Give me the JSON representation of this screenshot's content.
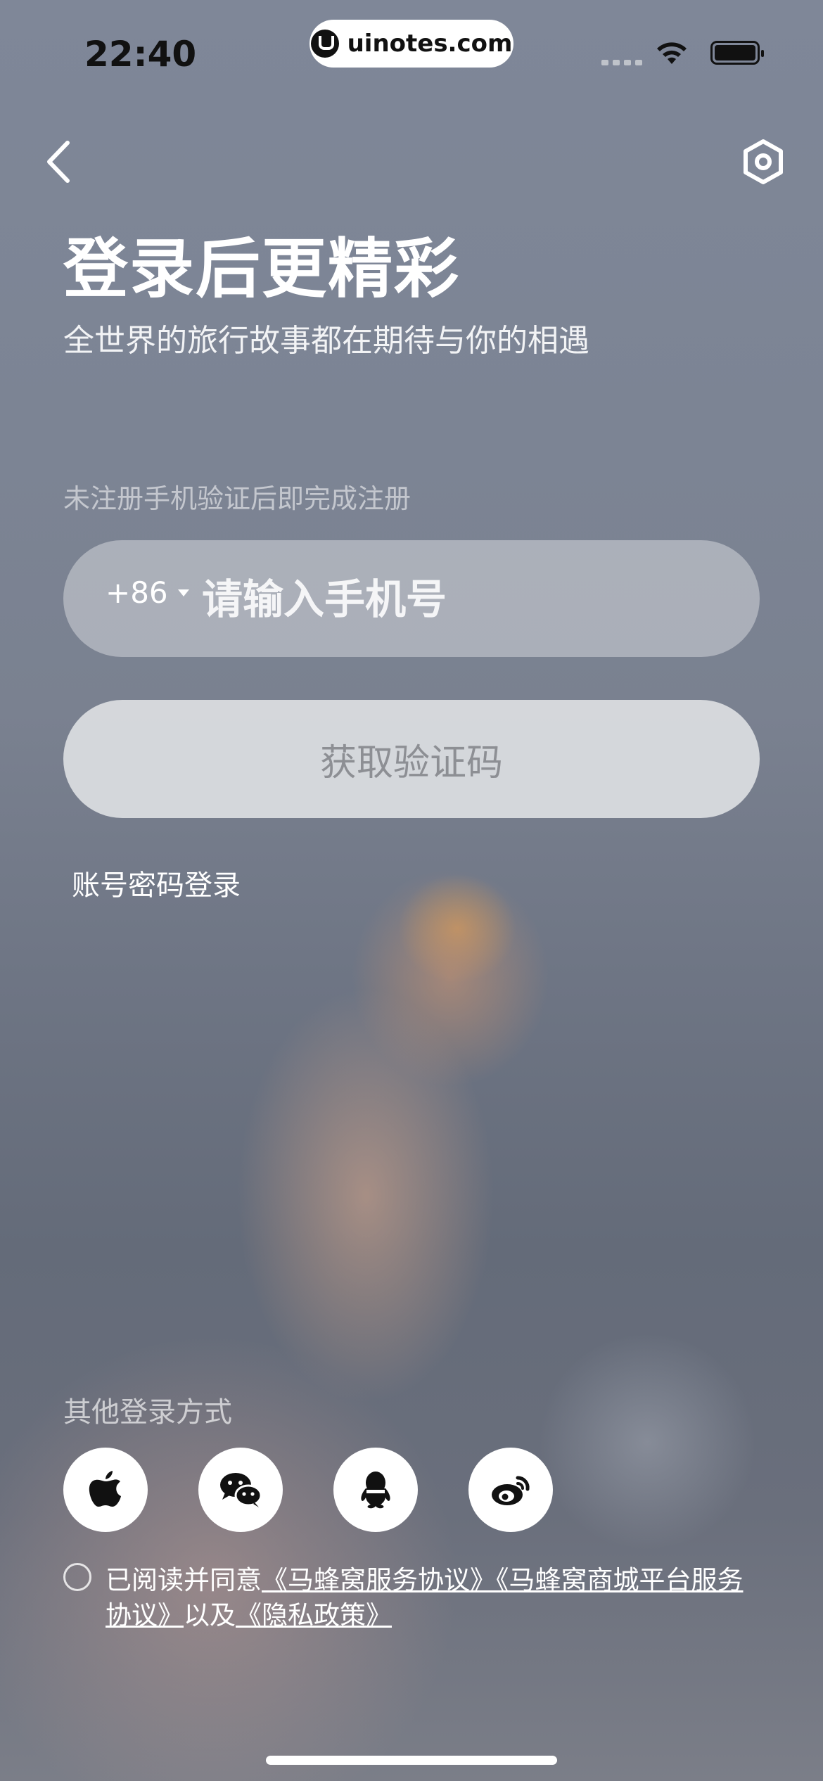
{
  "status_bar": {
    "time": "22:40",
    "url": "uinotes.com"
  },
  "header": {
    "back_icon": "chevron-left-icon",
    "settings_icon": "hexagon-settings-icon",
    "title": "登录后更精彩",
    "subtitle": "全世界的旅行故事都在期待与你的相遇"
  },
  "form": {
    "hint": "未注册手机验证后即完成注册",
    "country_code": "+86",
    "phone_placeholder": "请输入手机号",
    "phone_value": "",
    "get_code_label": "获取验证码",
    "password_login_link": "账号密码登录"
  },
  "other_login": {
    "label": "其他登录方式",
    "providers": [
      {
        "name": "apple-icon"
      },
      {
        "name": "wechat-icon"
      },
      {
        "name": "qq-icon"
      },
      {
        "name": "weibo-icon"
      }
    ]
  },
  "agreement": {
    "checked": false,
    "prefix": "已阅读并同意",
    "service_link": "《马蜂窝服务协议》",
    "mall_link": "《马蜂窝商城平台服务协议》",
    "joiner": "以及",
    "privacy_link": "《隐私政策》"
  },
  "colors": {
    "button_bg": "#dcdee2",
    "button_text": "#8d8f94",
    "field_bg": "#c8cbd2"
  }
}
